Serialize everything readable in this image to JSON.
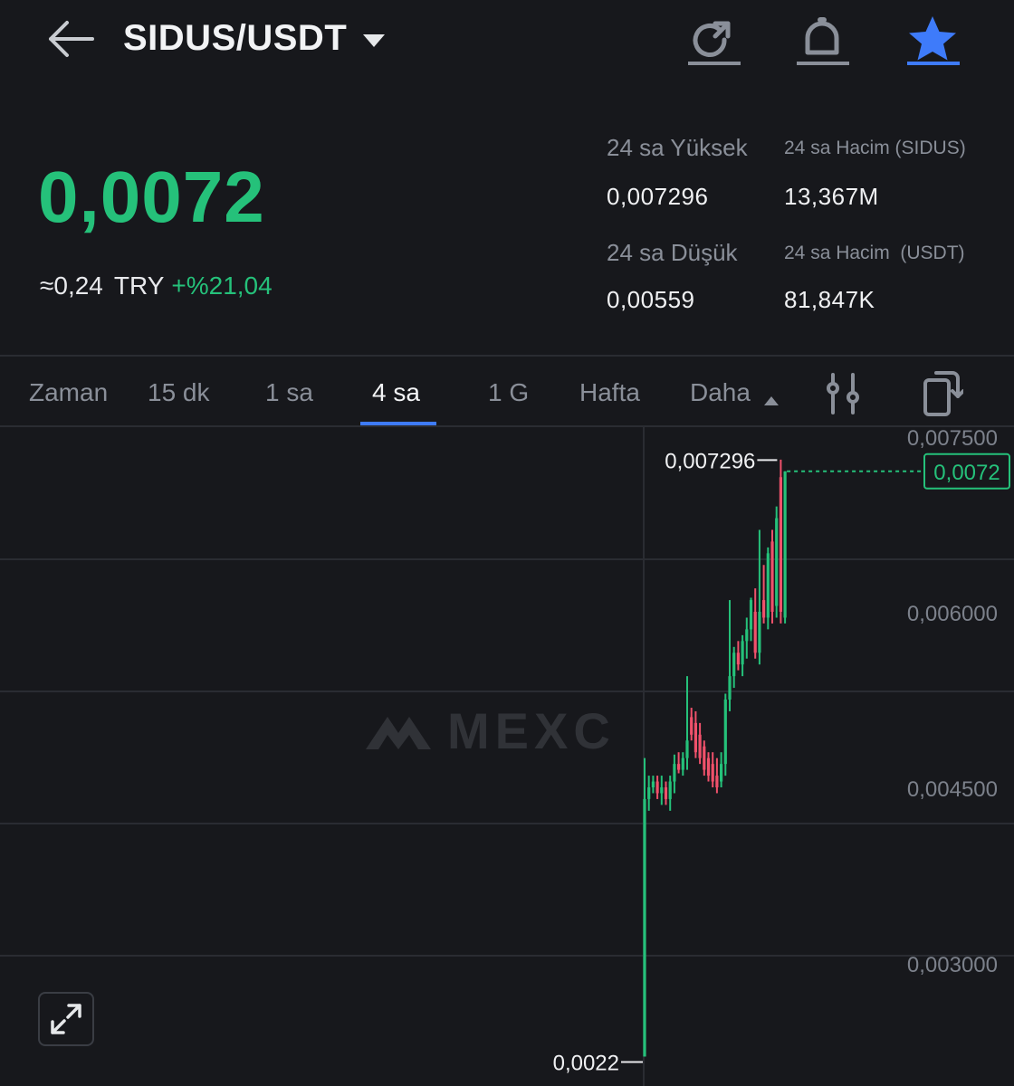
{
  "header": {
    "pair": "SIDUS/USDT",
    "icons": [
      "back-arrow-icon",
      "share-refresh-icon",
      "bell-icon",
      "star-icon"
    ],
    "accent": "#3e7bfa"
  },
  "ticker": {
    "last_price": "0,0072",
    "fiat_approx": "≈0,24",
    "fiat_currency": "TRY",
    "change_pct": "+%21,04",
    "up_color": "#25c17a",
    "down_color": "#f0516b"
  },
  "stats": {
    "high_label": "24 sa Yüksek",
    "high_value": "0,007296",
    "vol_base_label": "24 sa Hacim (SIDUS)",
    "vol_base_value": "13,367M",
    "low_label": "24 sa Düşük",
    "low_value": "0,00559",
    "vol_quote_label": "24 sa Hacim  (USDT)",
    "vol_quote_value": "81,847K"
  },
  "tabs": {
    "items": [
      "Zaman",
      "15 dk",
      "1 sa",
      "4 sa",
      "1 G",
      "Hafta",
      "Daha"
    ],
    "active": "4 sa"
  },
  "chart_data": {
    "type": "candlestick",
    "y_ticks": [
      "0,007500",
      "0,006000",
      "0,004500",
      "0,003000"
    ],
    "ylim": [
      0.00205,
      0.00755
    ],
    "grid": true,
    "watermark": "MEXC",
    "high_marker": "0,007296",
    "low_marker": "0,0022",
    "last_price_tag": "0,0072",
    "candles": [
      [
        0.0022,
        0.0022,
        0.00475,
        0.0044
      ],
      [
        0.0044,
        0.0043,
        0.0046,
        0.0045
      ],
      [
        0.0045,
        0.00445,
        0.0046,
        0.00455
      ],
      [
        0.00455,
        0.0044,
        0.0046,
        0.00445
      ],
      [
        0.00445,
        0.00435,
        0.0046,
        0.0045
      ],
      [
        0.0045,
        0.00435,
        0.00455,
        0.0044
      ],
      [
        0.0044,
        0.0043,
        0.0046,
        0.00455
      ],
      [
        0.00455,
        0.00445,
        0.00478,
        0.0047
      ],
      [
        0.0047,
        0.00462,
        0.0048,
        0.00465
      ],
      [
        0.00465,
        0.0046,
        0.0048,
        0.00475
      ],
      [
        0.00475,
        0.00465,
        0.00545,
        0.0049
      ],
      [
        0.0051,
        0.0049,
        0.00518,
        0.00495
      ],
      [
        0.00505,
        0.00475,
        0.00515,
        0.0048
      ],
      [
        0.00495,
        0.0047,
        0.00505,
        0.00475
      ],
      [
        0.00485,
        0.0046,
        0.0049,
        0.00465
      ],
      [
        0.00475,
        0.00455,
        0.0048,
        0.0046
      ],
      [
        0.0047,
        0.0045,
        0.0048,
        0.00455
      ],
      [
        0.0046,
        0.00445,
        0.00475,
        0.0045
      ],
      [
        0.00455,
        0.0045,
        0.0048,
        0.0047
      ],
      [
        0.0047,
        0.0046,
        0.0053,
        0.00525
      ],
      [
        0.00525,
        0.00515,
        0.0061,
        0.00545
      ],
      [
        0.00545,
        0.00535,
        0.0057,
        0.00565
      ],
      [
        0.00565,
        0.0055,
        0.00575,
        0.00555
      ],
      [
        0.00555,
        0.00545,
        0.0058,
        0.00575
      ],
      [
        0.00575,
        0.0056,
        0.00595,
        0.00585
      ],
      [
        0.00585,
        0.00575,
        0.00612,
        0.0061
      ],
      [
        0.006,
        0.0056,
        0.0062,
        0.00565
      ],
      [
        0.00565,
        0.00555,
        0.0067,
        0.006
      ],
      [
        0.0061,
        0.0059,
        0.0064,
        0.00595
      ],
      [
        0.00595,
        0.00585,
        0.00655,
        0.0065
      ],
      [
        0.0066,
        0.0059,
        0.0067,
        0.006
      ],
      [
        0.00605,
        0.00595,
        0.0069,
        0.0068
      ],
      [
        0.00715,
        0.0059,
        0.0073,
        0.006
      ],
      [
        0.00595,
        0.0059,
        0.0072,
        0.0072
      ]
    ]
  }
}
